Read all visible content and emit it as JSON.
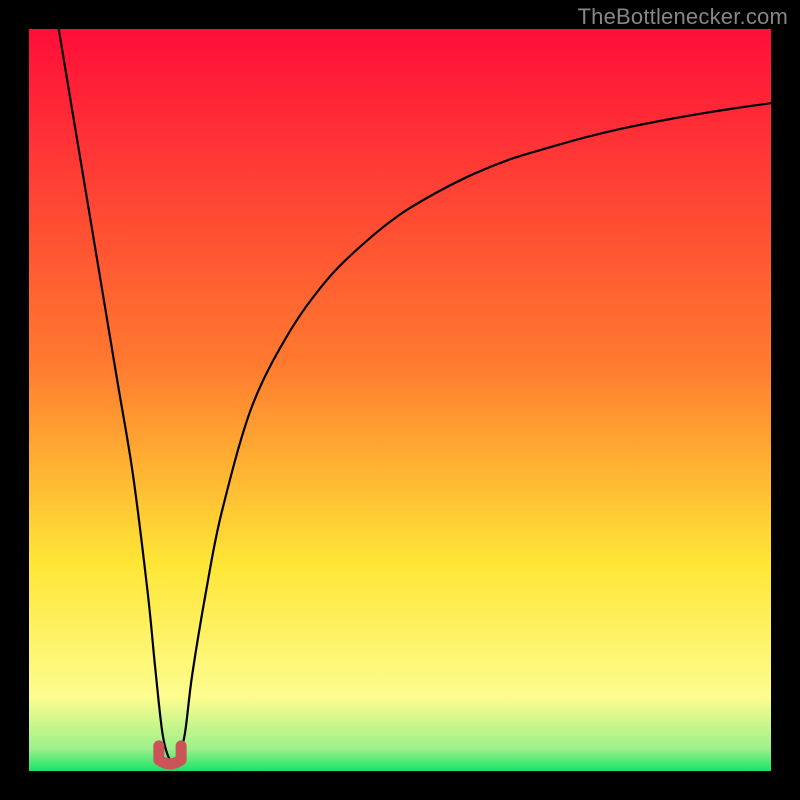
{
  "watermark": {
    "text": "TheBottlenecker.com"
  },
  "colors": {
    "red_top": "#ff0e39",
    "orange": "#ff7a2f",
    "yellow": "#ffe636",
    "pale_yellow": "#fdfd8f",
    "green": "#17e368",
    "curve": "#000000",
    "marker": "#cb5458",
    "frame": "#000000"
  },
  "chart_data": {
    "type": "line",
    "title": "",
    "xlabel": "",
    "ylabel": "",
    "xlim": [
      0,
      100
    ],
    "ylim": [
      0,
      100
    ],
    "optimum_x": 19,
    "series": [
      {
        "name": "bottleneck-curve",
        "x": [
          4,
          6,
          8,
          10,
          12,
          14,
          16,
          17,
          18,
          19,
          20,
          21,
          22,
          24,
          26,
          30,
          35,
          40,
          45,
          50,
          55,
          60,
          65,
          70,
          75,
          80,
          85,
          90,
          95,
          100
        ],
        "y": [
          100,
          88,
          76,
          64,
          52,
          40,
          24,
          14,
          5,
          1.5,
          1.5,
          5,
          13,
          25,
          35,
          49,
          59,
          66,
          71,
          75,
          78,
          80.5,
          82.5,
          84,
          85.4,
          86.6,
          87.6,
          88.5,
          89.3,
          90
        ]
      }
    ],
    "marker": {
      "x_range": [
        17.5,
        20.5
      ],
      "y": 1.5,
      "shape": "u"
    },
    "gradient_stops": [
      {
        "pct": 0,
        "color": "#ff0e39"
      },
      {
        "pct": 45,
        "color": "#ff7a2f"
      },
      {
        "pct": 72,
        "color": "#ffe636"
      },
      {
        "pct": 90,
        "color": "#fdfd8f"
      },
      {
        "pct": 97,
        "color": "#9df08a"
      },
      {
        "pct": 100,
        "color": "#17e368"
      }
    ]
  }
}
